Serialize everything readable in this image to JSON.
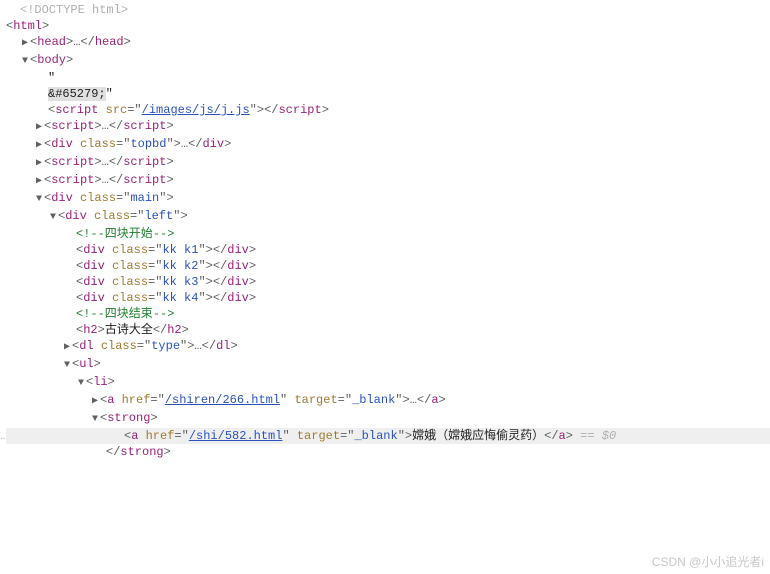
{
  "lines": {
    "doctype": "<!DOCTYPE html>",
    "html_open": "html",
    "head_open": "head",
    "head_close": "head",
    "body_open": "body",
    "quote1": "\"",
    "entity": "&#65279;",
    "quote2": "\"",
    "script_tag": "script",
    "src_attr": "src",
    "src_val": "/images/js/j.js",
    "script_close": "script",
    "div_tag": "div",
    "class_attr": "class",
    "topbd": "topbd",
    "main": "main",
    "left": "left",
    "comment_start": "<!--四块开始-->",
    "kk1": "kk k1",
    "kk2": "kk k2",
    "kk3": "kk k3",
    "kk4": "kk k4",
    "comment_end": "<!--四块结束-->",
    "h2_tag": "h2",
    "h2_text": "古诗大全",
    "dl_tag": "dl",
    "dl_class": "type",
    "ul_tag": "ul",
    "li_tag": "li",
    "a_tag": "a",
    "href_attr": "href",
    "href1": "/shiren/266.html",
    "href2": "/shi/582.html",
    "target_attr": "target",
    "target_val": "_blank",
    "strong_tag": "strong",
    "link_text": "嫦娥（嫦娥应悔偷灵药）",
    "eq0": " == $0",
    "ellipsis": "…"
  },
  "watermark": "CSDN @小小追光者i"
}
